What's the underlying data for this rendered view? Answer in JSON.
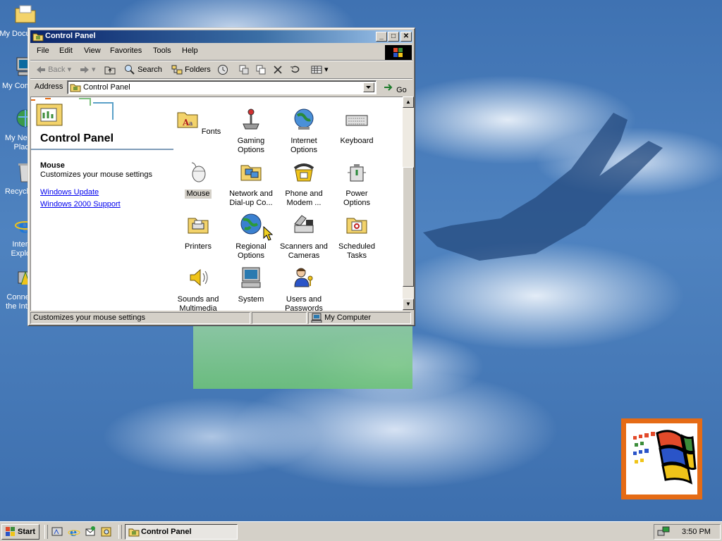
{
  "desktop": {
    "icons": [
      {
        "label_lines": [
          "My Documents"
        ],
        "icon": "folder-documents-icon"
      },
      {
        "label_lines": [
          "My Computer"
        ],
        "icon": "computer-icon"
      },
      {
        "label_lines": [
          "My Network",
          "Places"
        ],
        "icon": "network-icon"
      },
      {
        "label_lines": [
          "Recycle Bin"
        ],
        "icon": "recycle-bin-icon"
      },
      {
        "label_lines": [
          "Internet",
          "Explorer"
        ],
        "icon": "internet-explorer-icon"
      },
      {
        "label_lines": [
          "Connect to",
          "the Internet"
        ],
        "icon": "connect-internet-icon"
      }
    ]
  },
  "window": {
    "title": "Control Panel",
    "menu": [
      "File",
      "Edit",
      "View",
      "Favorites",
      "Tools",
      "Help"
    ],
    "toolbar": {
      "back": "Back",
      "search": "Search",
      "folders": "Folders"
    },
    "address": {
      "label": "Address",
      "value": "Control Panel",
      "go": "Go"
    },
    "sidebar": {
      "title": "Control Panel",
      "selected_name": "Mouse",
      "selected_desc": "Customizes your mouse settings",
      "links": [
        "Windows Update",
        "Windows 2000 Support"
      ]
    },
    "items": [
      {
        "label_lines": [
          "Fonts"
        ],
        "icon": "fonts-icon"
      },
      {
        "label_lines": [
          "Gaming",
          "Options"
        ],
        "icon": "joystick-icon"
      },
      {
        "label_lines": [
          "Internet",
          "Options"
        ],
        "icon": "globe-icon"
      },
      {
        "label_lines": [
          "Keyboard"
        ],
        "icon": "keyboard-icon"
      },
      {
        "label_lines": [
          "Mouse"
        ],
        "icon": "mouse-icon",
        "selected": true
      },
      {
        "label_lines": [
          "Network and",
          "Dial-up Co..."
        ],
        "icon": "network-folder-icon"
      },
      {
        "label_lines": [
          "Phone and",
          "Modem ..."
        ],
        "icon": "phone-icon"
      },
      {
        "label_lines": [
          "Power Options"
        ],
        "icon": "power-icon"
      },
      {
        "label_lines": [
          "Printers"
        ],
        "icon": "printer-folder-icon"
      },
      {
        "label_lines": [
          "Regional",
          "Options"
        ],
        "icon": "regional-globe-icon"
      },
      {
        "label_lines": [
          "Scanners and",
          "Cameras"
        ],
        "icon": "scanner-icon"
      },
      {
        "label_lines": [
          "Scheduled",
          "Tasks"
        ],
        "icon": "scheduled-tasks-icon"
      },
      {
        "label_lines": [
          "Sounds and",
          "Multimedia"
        ],
        "icon": "speaker-icon"
      },
      {
        "label_lines": [
          "System"
        ],
        "icon": "system-computer-icon"
      },
      {
        "label_lines": [
          "Users and",
          "Passwords"
        ],
        "icon": "users-keys-icon"
      }
    ],
    "status": {
      "text": "Customizes your mouse settings",
      "zone": "My Computer"
    }
  },
  "taskbar": {
    "start": "Start",
    "task_title": "Control Panel",
    "clock": "3:50 PM"
  },
  "colors": {
    "title_active": "#0a246a",
    "face": "#d4d0c8",
    "desktop": "#3a6ea5",
    "link": "#0000ee"
  }
}
